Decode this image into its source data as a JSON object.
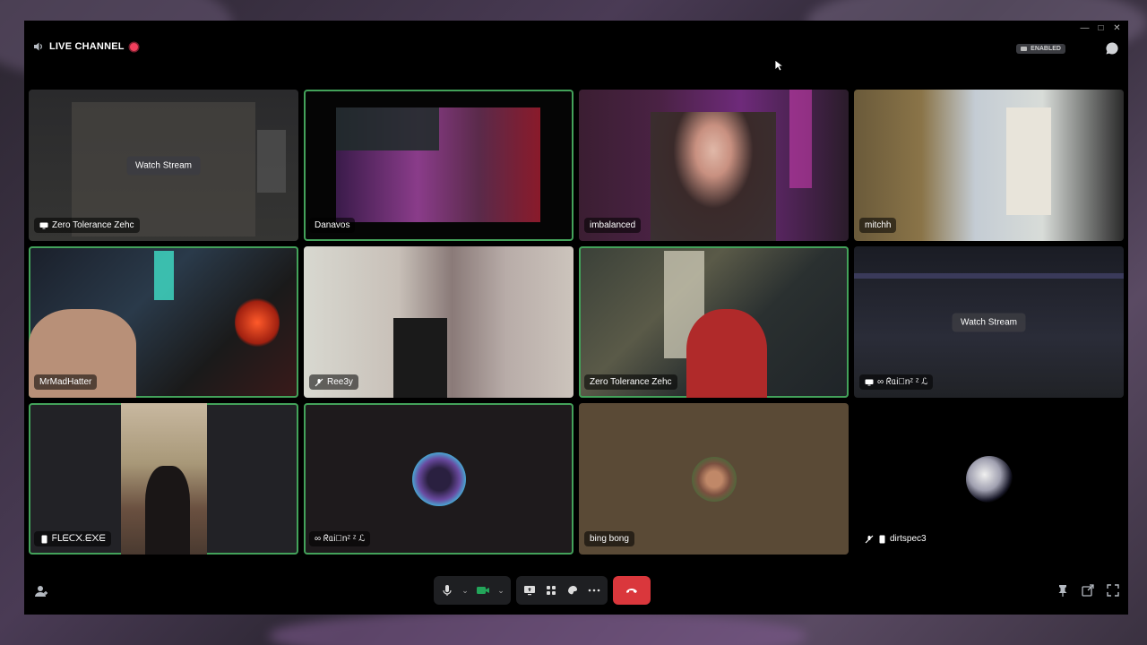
{
  "window": {
    "title": "LIVE CHANNEL",
    "controls": [
      "minimize-icon",
      "maximize-icon",
      "close-icon"
    ],
    "enabled_badge": "ENABLED"
  },
  "tiles": [
    {
      "name": "Zero Tolerance Zehc",
      "type": "stream",
      "watch": "Watch Stream",
      "icon": "screen-icon",
      "speaking": false
    },
    {
      "name": "Danavos",
      "type": "video",
      "speaking": true
    },
    {
      "name": "imbalanced",
      "type": "video",
      "speaking": false
    },
    {
      "name": "mitchh",
      "type": "video",
      "speaking": false
    },
    {
      "name": "MrMadHatter",
      "type": "video",
      "speaking": true
    },
    {
      "name": "Ree3y",
      "type": "video",
      "icon": "muted-mic-icon",
      "speaking": false
    },
    {
      "name": "Zero Tolerance Zehc",
      "type": "video",
      "speaking": true
    },
    {
      "name": "∞ ᖇᥲi⃝nᶻ ᶻ ℒ",
      "type": "stream",
      "watch": "Watch Stream",
      "icon": "screen-icon",
      "speaking": false
    },
    {
      "name": "ᖴᒪᗴᑕ᙭.ᗴ᙭ᗴ",
      "type": "video",
      "icon": "phone-icon",
      "speaking": true
    },
    {
      "name": "∞ ᖇᥲi⃝nᶻ ᶻ ℒ",
      "type": "avatar",
      "speaking": true
    },
    {
      "name": "bing bong",
      "type": "avatar",
      "speaking": false
    },
    {
      "name": "dirtspec3",
      "type": "avatar",
      "icon": "muted-mic-icon",
      "speaking": false
    }
  ],
  "controls": {
    "mic": "microphone-icon",
    "camera": "camera-icon",
    "share": "screen-share-icon",
    "activities": "activities-icon",
    "soundboard": "soundboard-icon",
    "more": "more-icon",
    "leave": "disconnect-icon"
  },
  "colors": {
    "speaking": "#43a25a",
    "live": "#f23f5d",
    "leave": "#da373c",
    "camera_on": "#23a55a"
  }
}
